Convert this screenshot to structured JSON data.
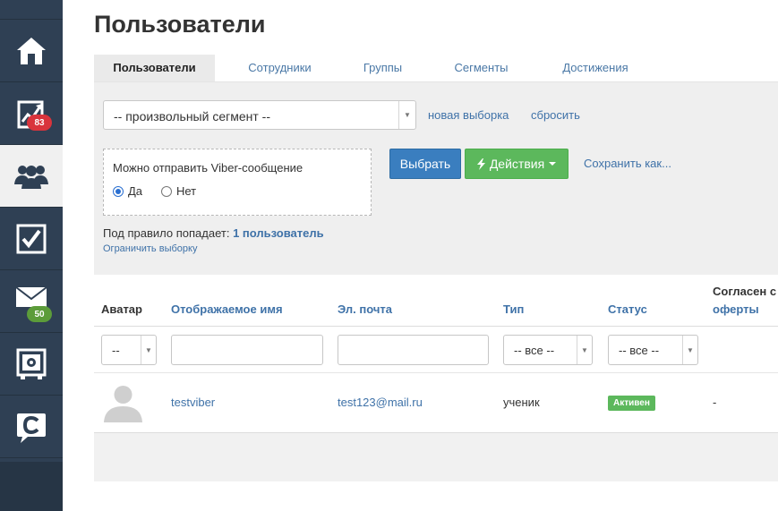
{
  "sidebar": {
    "items": [
      {
        "icon": "home-icon"
      },
      {
        "icon": "chart-icon",
        "badge": "83",
        "badge_color": "#d9343c"
      },
      {
        "icon": "users-icon",
        "active": true
      },
      {
        "icon": "checkbox-icon"
      },
      {
        "icon": "mail-icon",
        "badge": "50",
        "badge_color": "#5c9c3a"
      },
      {
        "icon": "safe-icon"
      },
      {
        "icon": "chat-c-icon"
      }
    ]
  },
  "page": {
    "title": "Пользователи"
  },
  "tabs": [
    "Пользователи",
    "Сотрудники",
    "Группы",
    "Сегменты",
    "Достижения"
  ],
  "filter": {
    "segment_value": "-- произвольный сегмент --",
    "new_selection": "новая выборка",
    "reset": "сбросить",
    "condition_label": "Можно отправить Viber-сообщение",
    "radio_yes": "Да",
    "radio_no": "Нет",
    "btn_select": "Выбрать",
    "btn_actions": "Действия",
    "save_as": "Сохранить как...",
    "rule_prefix": "Под правило попадает:",
    "rule_count": "1 пользователь",
    "limit": "Ограничить выборку"
  },
  "table": {
    "headers": {
      "avatar": "Аватар",
      "name": "Отображаемое имя",
      "email": "Эл. почта",
      "type": "Тип",
      "status": "Статус",
      "offer_line1": "Согласен с",
      "offer_line2": "оферты"
    },
    "filters": {
      "avatar": "--",
      "type": "-- все --",
      "status": "-- все --"
    },
    "rows": [
      {
        "name": "testviber",
        "email": "test123@mail.ru",
        "type": "ученик",
        "status": "Активен",
        "offer": "-"
      }
    ]
  },
  "colors": {
    "sidebar_bg": "#2f4054",
    "link": "#3f72a8",
    "primary": "#3a7ebf",
    "success": "#5cb85c"
  }
}
